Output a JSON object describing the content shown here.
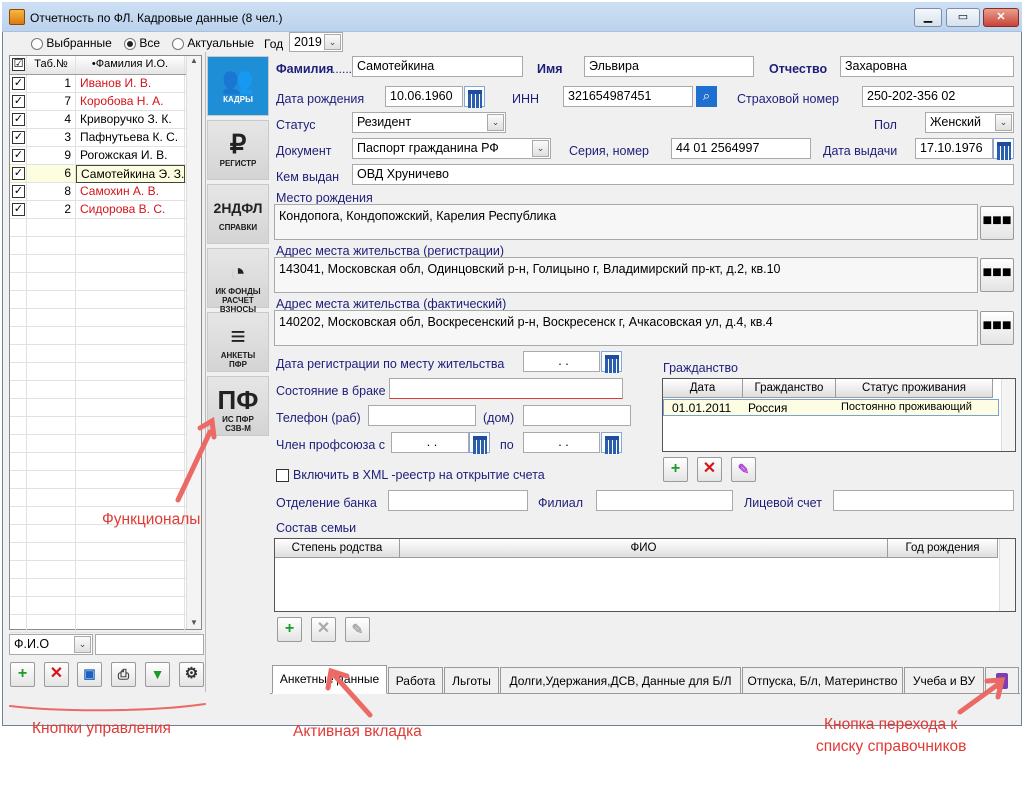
{
  "window": {
    "title": "Отчетность по ФЛ. Кадровые данные (8 чел.)",
    "min": "▁",
    "max": "▭",
    "close": "✕"
  },
  "filter": {
    "opt1": "Выбранные",
    "opt2": "Все",
    "opt3": "Актуальные",
    "year_label": "Год",
    "year": "2019"
  },
  "grid": {
    "col_check": "☑",
    "col_num": "Таб.№",
    "col_name": "•Фамилия И.О.",
    "rows": [
      {
        "num": "1",
        "name": "Иванов И. В.",
        "red": true
      },
      {
        "num": "7",
        "name": "Коробова Н. А.",
        "red": true
      },
      {
        "num": "4",
        "name": "Криворучко З. К.",
        "red": false
      },
      {
        "num": "3",
        "name": "Пафнутьева К. С.",
        "red": false
      },
      {
        "num": "9",
        "name": "Рогожская И. В.",
        "red": false
      },
      {
        "num": "6",
        "name": "Самотейкина Э. З.",
        "red": false
      },
      {
        "num": "8",
        "name": "Самохин А. В.",
        "red": true
      },
      {
        "num": "2",
        "name": "Сидорова В. С.",
        "red": true
      }
    ]
  },
  "search": {
    "field": "Ф.И.О",
    "value": ""
  },
  "nav": [
    {
      "icon": "👥",
      "cap1": "КАДРЫ",
      "cap2": ""
    },
    {
      "icon": "₽",
      "cap1": "РЕГИСТР",
      "cap2": ""
    },
    {
      "icon": "2НДФЛ",
      "cap1": "СПРАВКИ",
      "cap2": ""
    },
    {
      "icon": "◔",
      "cap1": "ИК ФОНДЫ",
      "cap2": "РАСЧЕТ ВЗНОСЫ"
    },
    {
      "icon": "≡",
      "cap1": "АНКЕТЫ",
      "cap2": "ПФР"
    },
    {
      "icon": "ПФ",
      "cap1": "ИС ПФР",
      "cap2": "СЗВ-М"
    }
  ],
  "form": {
    "surname_label": "Фамилия",
    "surname": "Самотейкина",
    "name_label": "Имя",
    "name": "Эльвира",
    "patronymic_label": "Отчество",
    "patronymic": "Захаровна",
    "birth_label": "Дата рождения",
    "birth": "10.06.1960",
    "inn_label": "ИНН",
    "inn": "321654987451",
    "snils_label": "Страховой номер",
    "snils": "250-202-356 02",
    "status_label": "Статус",
    "status": "Резидент",
    "sex_label": "Пол",
    "sex": "Женский",
    "doc_label": "Документ",
    "doc": "Паспорт гражданина РФ",
    "series_label": "Серия, номер",
    "series": "44 01 2564997",
    "issue_date_label": "Дата выдачи",
    "issue_date": "17.10.1976",
    "issued_by_label": "Кем выдан",
    "issued_by": "ОВД Хруничево",
    "birthplace_label": "Место рождения",
    "birthplace": "Кондопога, Кондопожский, Карелия Республика",
    "reg_addr_label": "Адрес места жительства (регистрации)",
    "reg_addr": "143041, Московская обл, Одинцовский р-н, Голицыно г, Владимирский пр-кт, д.2, кв.10",
    "fact_addr_label": "Адрес места жительства (фактический)",
    "fact_addr": "140202, Московская обл, Воскресенский р-н, Воскресенск г, Ачкасовская ул, д.4, кв.4",
    "reg_date_label": "Дата регистрации по месту жительства",
    "reg_date": ". .",
    "marital_label": "Состояние в браке",
    "marital": "",
    "phone_work_label": "Телефон (раб)",
    "phone_home_label": "(дом)",
    "union_label": "Член профсоюза с",
    "union_from": ". .",
    "union_to_label": "по",
    "union_to": ". .",
    "xml_label": "Включить в XML -реестр на открытие счета",
    "bank_label": "Отделение банка",
    "branch_label": "Филиал",
    "account_label": "Лицевой счет",
    "family_label": "Состав семьи",
    "family_cols": [
      "Степень родства",
      "ФИО",
      "Год рождения"
    ],
    "citizenship_label": "Гражданство",
    "cit_cols": [
      "Дата",
      "Гражданство",
      "Статус проживания"
    ],
    "cit_row": {
      "date": "01.01.2011",
      "country": "Россия",
      "status": "Постоянно проживающий"
    },
    "dots": "■■■"
  },
  "tabs": [
    "Анкетные данные",
    "Работа",
    "Льготы",
    "Долги,Удержания,ДСВ, Данные для Б/Л",
    "Отпуска, Б/л, Материнство",
    "Учеба и ВУ"
  ],
  "annotations": {
    "func": "Функционалы",
    "controls": "Кнопки управления",
    "active_tab": "Активная вкладка",
    "ref_btn1": "Кнопка перехода к",
    "ref_btn2": "списку справочников"
  },
  "colors": {
    "accent": "#1e8fd6",
    "red": "#d4141a",
    "annotation": "#e03a36",
    "green": "#1a9c2a"
  }
}
